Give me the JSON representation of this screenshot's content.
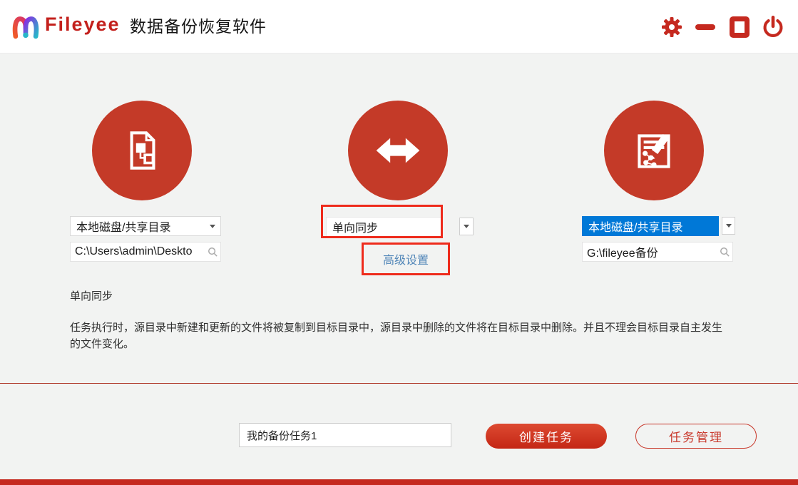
{
  "colors": {
    "accent_red": "#c5291f",
    "circle_red": "#c43a28",
    "selection_blue": "#0078d7",
    "link_blue": "#5186b8",
    "annotation_red": "#ee2b1c",
    "background_gray": "#f2f3f2"
  },
  "header": {
    "brand": "Fileyee",
    "app_title": "数据备份恢复软件"
  },
  "source": {
    "type_value": "本地磁盘/共享目录",
    "path_value": "C:\\Users\\admin\\Deskto"
  },
  "sync": {
    "mode_value": "单向同步",
    "advanced_settings_label": "高级设置"
  },
  "target": {
    "type_value": "本地磁盘/共享目录",
    "path_value": "G:\\fileyee备份"
  },
  "description": {
    "heading": "单向同步",
    "body": "任务执行时，源目录中新建和更新的文件将被复制到目标目录中，源目录中删除的文件将在目标目录中删除。并且不理会目标目录自主发生的文件变化。"
  },
  "task_bar": {
    "task_name_value": "我的备份任务1",
    "create_button_label": "创建任务",
    "manage_button_label": "任务管理"
  }
}
